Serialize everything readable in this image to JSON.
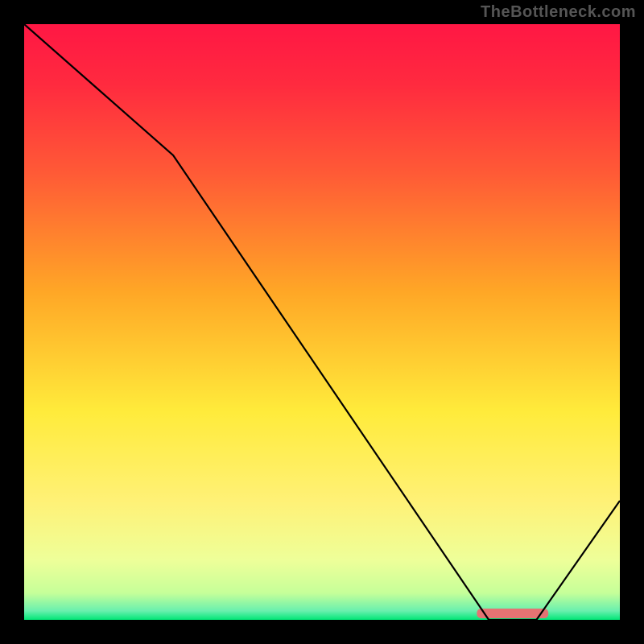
{
  "watermark": "TheBottleneck.com",
  "chart_data": {
    "type": "line",
    "title": "",
    "xlabel": "",
    "ylabel": "",
    "xlim": [
      0,
      100
    ],
    "ylim": [
      0,
      100
    ],
    "x": [
      0,
      25,
      78,
      86,
      100
    ],
    "values": [
      100,
      78,
      0,
      0,
      20
    ],
    "optimum_band": {
      "x_start": 76,
      "x_end": 88
    },
    "gradient_stops": [
      {
        "offset": 0.0,
        "color": "#ff1744"
      },
      {
        "offset": 0.1,
        "color": "#ff2a3f"
      },
      {
        "offset": 0.25,
        "color": "#ff5a36"
      },
      {
        "offset": 0.45,
        "color": "#ffa726"
      },
      {
        "offset": 0.65,
        "color": "#ffeb3b"
      },
      {
        "offset": 0.8,
        "color": "#fff176"
      },
      {
        "offset": 0.9,
        "color": "#eeff99"
      },
      {
        "offset": 0.955,
        "color": "#c6ff99"
      },
      {
        "offset": 0.985,
        "color": "#69f0ae"
      },
      {
        "offset": 1.0,
        "color": "#00e676"
      }
    ],
    "marker_color": "#e57373"
  }
}
